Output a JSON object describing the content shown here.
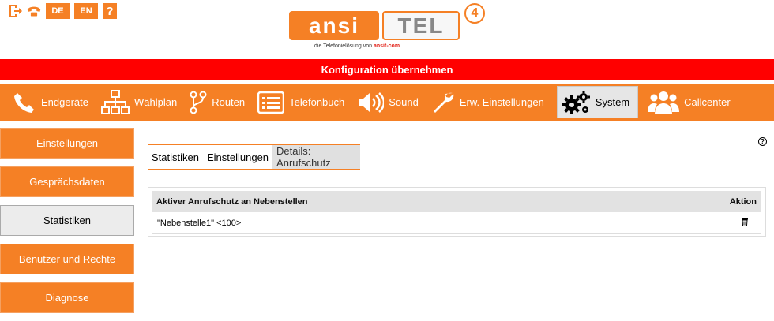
{
  "header": {
    "icons": [
      {
        "name": "logout-icon"
      },
      {
        "name": "phone-icon"
      }
    ],
    "lang_de": "DE",
    "lang_en": "EN",
    "help_label": "?",
    "logo": {
      "left_text": "ansi",
      "right_text": "TEL",
      "version": "4",
      "tagline_prefix": "die Telefonielösung von",
      "tagline_brand": "ansit-com"
    }
  },
  "apply_bar": {
    "label": "Konfiguration übernehmen"
  },
  "nav": {
    "items": [
      {
        "label": "Endgeräte",
        "icon": "phone-icon"
      },
      {
        "label": "Wählplan",
        "icon": "sitemap-icon"
      },
      {
        "label": "Routen",
        "icon": "route-icon"
      },
      {
        "label": "Telefonbuch",
        "icon": "list-icon"
      },
      {
        "label": "Sound",
        "icon": "speaker-icon"
      },
      {
        "label": "Erw. Einstellungen",
        "icon": "wrench-icon"
      },
      {
        "label": "System",
        "icon": "gears-icon",
        "active": true
      },
      {
        "label": "Callcenter",
        "icon": "users-icon"
      }
    ]
  },
  "sidebar": {
    "items": [
      {
        "label": "Einstellungen"
      },
      {
        "label": "Gesprächsdaten"
      },
      {
        "label": "Statistiken",
        "active": true
      },
      {
        "label": "Benutzer und Rechte"
      },
      {
        "label": "Diagnose"
      }
    ]
  },
  "main": {
    "help": "?",
    "tabs": [
      {
        "label": "Statistiken"
      },
      {
        "label": "Einstellungen"
      },
      {
        "label": "Details: Anrufschutz",
        "active": true
      }
    ],
    "table": {
      "columns": [
        "Aktiver Anrufschutz an Nebenstellen",
        "Aktion"
      ],
      "rows": [
        {
          "extension": "\"Nebenstelle1\" <100>",
          "action_icon": "trash-icon"
        }
      ]
    }
  },
  "colors": {
    "accent": "#f58025",
    "alert": "#ff0000"
  }
}
